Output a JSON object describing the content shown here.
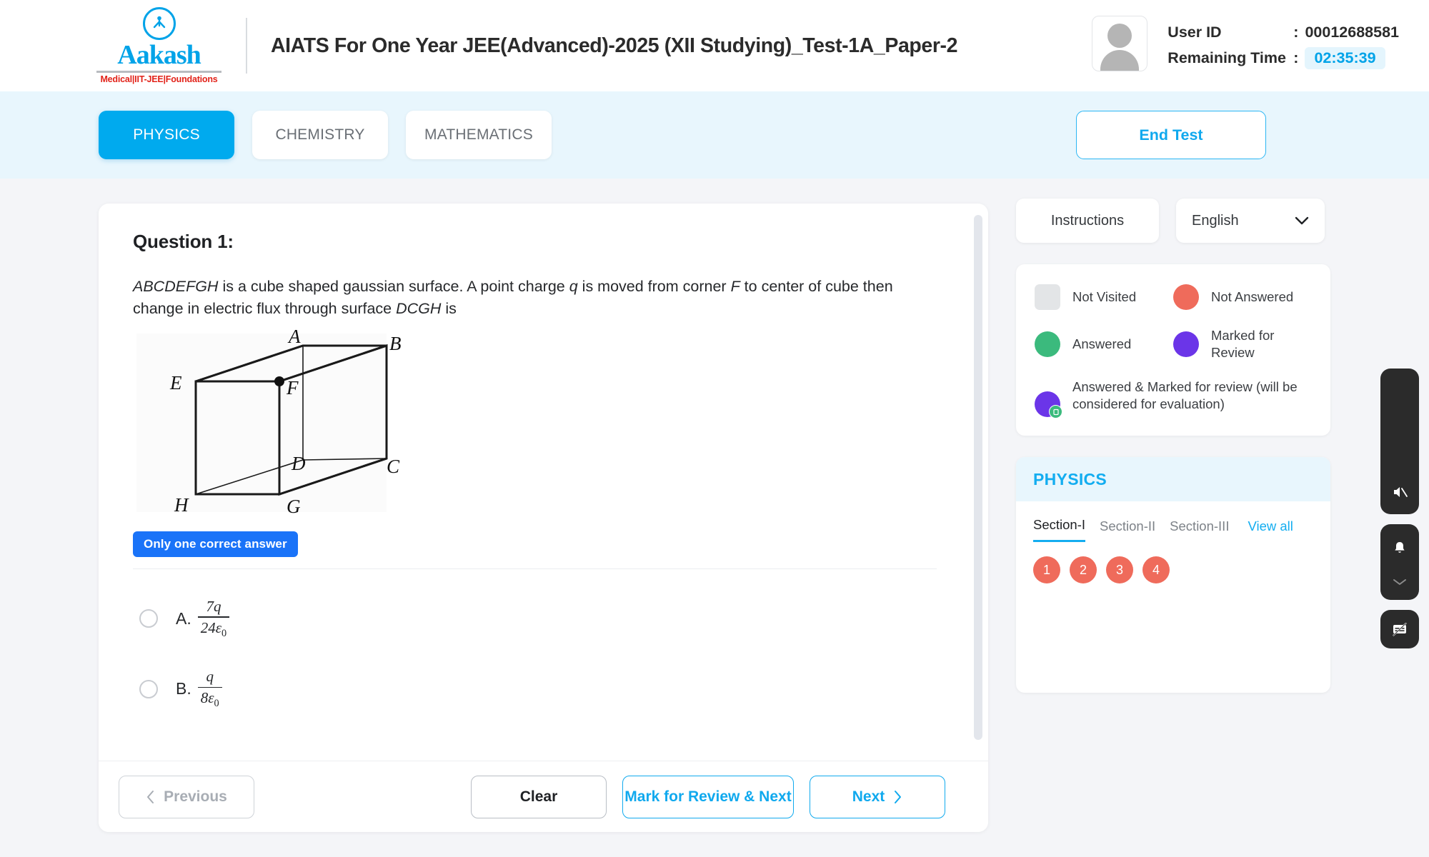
{
  "header": {
    "logo_word": "Aakash",
    "logo_sub": "Medical|IIT-JEE|Foundations",
    "title": "AIATS For One Year JEE(Advanced)-2025 (XII Studying)_Test-1A_Paper-2",
    "user_id_label": "User ID",
    "user_id_value": "00012688581",
    "remaining_time_label": "Remaining Time",
    "remaining_time_value": "02:35:39",
    "colon": ":"
  },
  "tabs": [
    {
      "label": "PHYSICS",
      "active": true
    },
    {
      "label": "CHEMISTRY",
      "active": false
    },
    {
      "label": "MATHEMATICS",
      "active": false
    }
  ],
  "end_test_label": "End Test",
  "question": {
    "title": "Question 1:",
    "text_part1": "ABCDEFGH",
    "text_part2": " is a cube shaped gaussian surface. A point charge ",
    "text_q": "q",
    "text_part3": " is moved from corner ",
    "text_f": "F",
    "text_part4": " to center of cube then change in electric flux through surface ",
    "text_dcgh": "DCGH",
    "text_part5": " is",
    "badge": "Only one correct answer",
    "figure_labels": [
      "A",
      "B",
      "E",
      "F",
      "D",
      "C",
      "H",
      "G"
    ],
    "options": [
      {
        "letter": "A.",
        "numerator": "7q",
        "denominator": "24ε",
        "denominator_sub": "0",
        "selected": false
      },
      {
        "letter": "B.",
        "numerator": "q",
        "denominator": "8ε",
        "denominator_sub": "0",
        "selected": false
      }
    ]
  },
  "footer": {
    "previous": "Previous",
    "clear": "Clear",
    "mark_review_next": "Mark for Review & Next",
    "next": "Next"
  },
  "right_panel": {
    "instructions": "Instructions",
    "language": "English",
    "legend": [
      {
        "label": "Not Visited",
        "color": "#e3e5e7",
        "shape": "square"
      },
      {
        "label": "Not Answered",
        "color": "#ef6b5b",
        "shape": "circle"
      },
      {
        "label": "Answered",
        "color": "#3bba7d",
        "shape": "circle"
      },
      {
        "label": "Marked for Review",
        "color": "#6b35e8",
        "shape": "circle"
      }
    ],
    "legend_wide": {
      "label": "Answered & Marked for review (will be considered for evaluation)",
      "color": "#6b35e8",
      "badge_color": "#3bba7d"
    },
    "palette_title": "PHYSICS",
    "sections": [
      {
        "label": "Section-I",
        "active": true
      },
      {
        "label": "Section-II",
        "active": false
      },
      {
        "label": "Section-III",
        "active": false
      }
    ],
    "view_all": "View all",
    "question_numbers": [
      {
        "n": "1",
        "status": "not-answered"
      },
      {
        "n": "2",
        "status": "not-answered"
      },
      {
        "n": "3",
        "status": "not-answered"
      },
      {
        "n": "4",
        "status": "not-answered"
      }
    ]
  },
  "float_toolbar": [
    {
      "icon": "speaker-muted-icon"
    },
    {
      "icon": "bell-icon"
    },
    {
      "icon": "chevron-down-icon"
    },
    {
      "icon": "subtitles-off-icon"
    }
  ],
  "colors": {
    "accent": "#00aaee",
    "badge_blue": "#1a73f8",
    "not_answered": "#ef6b5b",
    "answered": "#3bba7d",
    "marked": "#6b35e8",
    "logo_blue": "#00a3e8",
    "logo_red": "#e2231a"
  }
}
